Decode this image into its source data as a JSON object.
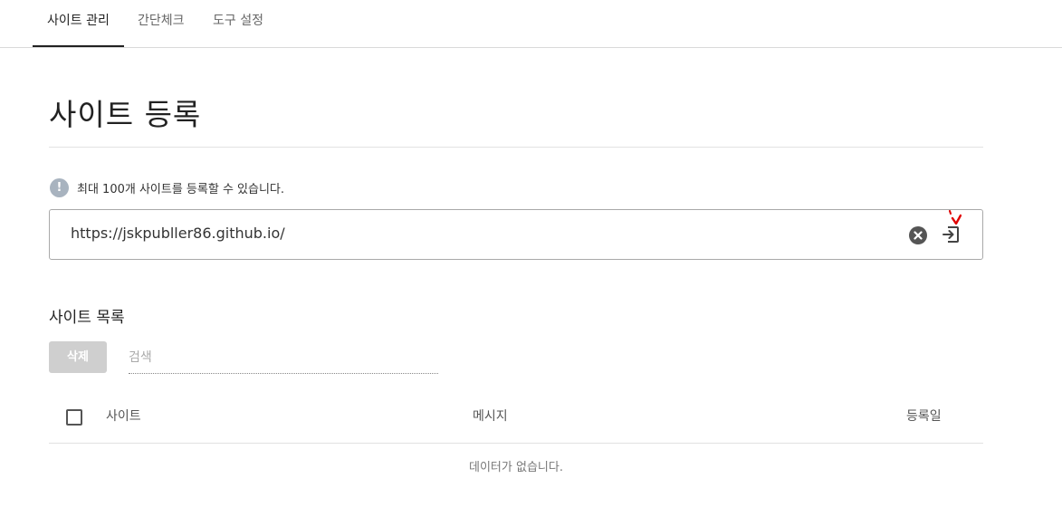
{
  "tabs": [
    {
      "label": "사이트 관리",
      "active": true
    },
    {
      "label": "간단체크",
      "active": false
    },
    {
      "label": "도구 설정",
      "active": false
    }
  ],
  "page": {
    "title": "사이트 등록",
    "notice": "최대 100개 사이트를 등록할 수 있습니다.",
    "notice_icon": "exclamation-icon"
  },
  "url_input": {
    "value": "https://jskpubller86.github.io/",
    "clear_icon": "close-circle-icon",
    "submit_icon": "login-arrow-icon"
  },
  "site_list": {
    "title": "사이트 목록",
    "delete_label": "삭제",
    "search_placeholder": "검색",
    "columns": [
      "사이트",
      "메시지",
      "등록일"
    ],
    "empty_message": "데이터가 없습니다."
  },
  "colors": {
    "accent": "#222222",
    "notice_icon_bg": "#a8b3bf",
    "disabled_button": "#cfcfcf",
    "cursor_mark": "#e00000"
  }
}
